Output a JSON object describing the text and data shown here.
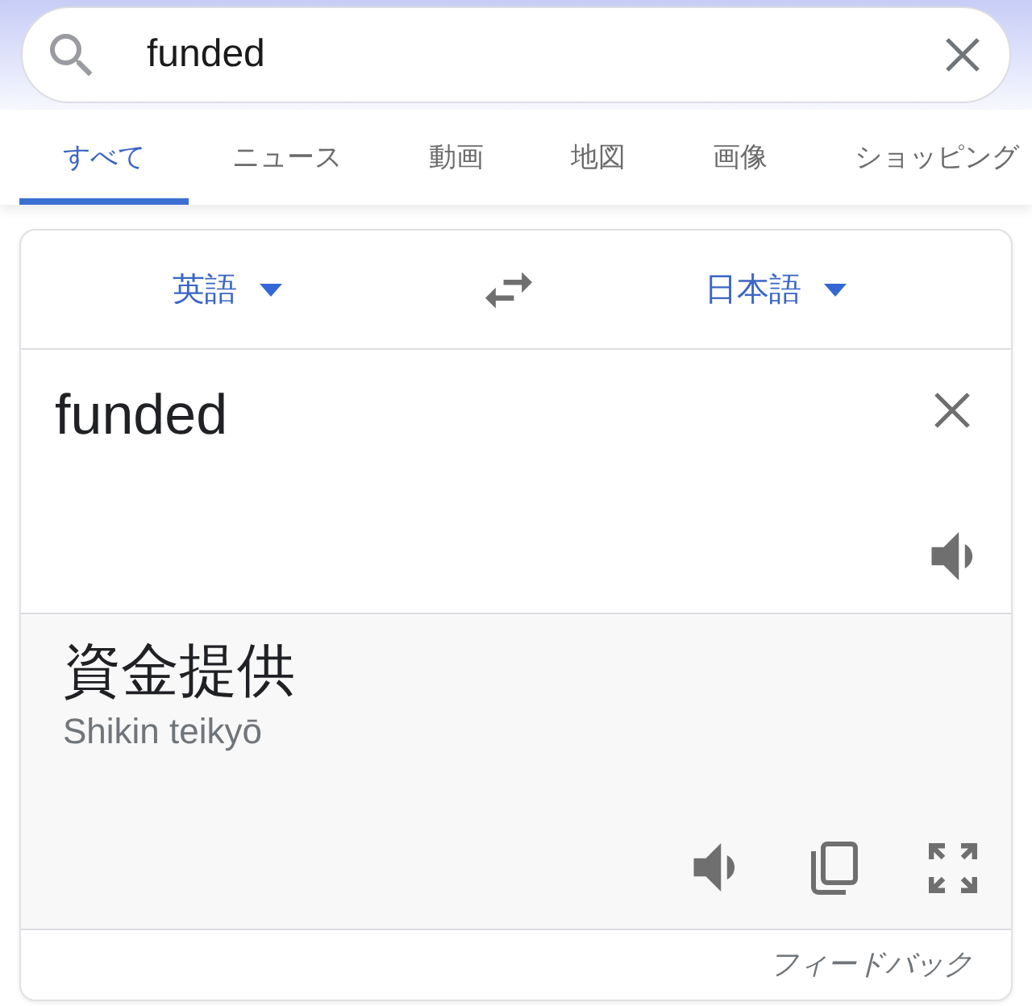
{
  "search": {
    "value": "funded"
  },
  "tabs": [
    {
      "label": "すべて",
      "selected": true
    },
    {
      "label": "ニュース",
      "selected": false
    },
    {
      "label": "動画",
      "selected": false
    },
    {
      "label": "地図",
      "selected": false
    },
    {
      "label": "画像",
      "selected": false
    },
    {
      "label": "ショッピング",
      "selected": false
    }
  ],
  "translator": {
    "source_language": "英語",
    "target_language": "日本語",
    "source_text": "funded",
    "translation": "資金提供",
    "romanization": "Shikin teikyō",
    "feedback_link": "フィードバック"
  }
}
